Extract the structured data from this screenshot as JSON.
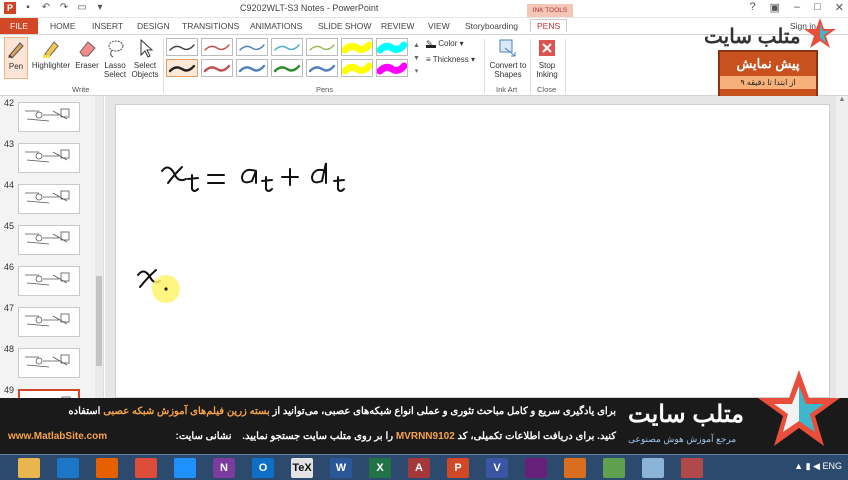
{
  "window": {
    "title": "C9202WLT-S3 Notes - PowerPoint",
    "sign_in": "Sign in"
  },
  "tabs": {
    "file": "FILE",
    "items": [
      "HOME",
      "INSERT",
      "DESIGN",
      "TRANSITIONS",
      "ANIMATIONS",
      "SLIDE SHOW",
      "REVIEW",
      "VIEW",
      "Storyboarding"
    ],
    "active": "PENS",
    "context_group": "INK TOOLS"
  },
  "ribbon": {
    "write": {
      "pen": "Pen",
      "highlighter": "Highlighter",
      "eraser": "Eraser",
      "lasso_select": "Lasso Select",
      "select_objects": "Select Objects",
      "group_label": "Write"
    },
    "pens": {
      "group_label": "Pens",
      "color": "Color",
      "thickness": "Thickness",
      "swatches_row1": [
        "#444444",
        "#c0504d",
        "#4f81bd",
        "#4bacc6",
        "#9bbb59",
        "#ffff00",
        "#00ffff"
      ],
      "swatches_row2": [
        "#222222",
        "#c0504d",
        "#4f81bd",
        "#2c8c2c",
        "#4f81bd",
        "#ffff00",
        "#ff00ff"
      ]
    },
    "ink_art": {
      "convert": "Convert to Shapes",
      "group_label": "Ink Art"
    },
    "close": {
      "stop_inking": "Stop Inking",
      "group_label": "Close"
    }
  },
  "watermark": {
    "logo": "متلب سایت",
    "promo_title": "پیش نمایش",
    "promo_sub": "از ابتدا تا دقیقه ۹"
  },
  "slides_panel": {
    "numbers": [
      "42",
      "43",
      "44",
      "45",
      "46",
      "47",
      "48",
      "49"
    ],
    "active": "49"
  },
  "banner": {
    "line1_a": "برای یادگیری سریع و کامل مباحث تئوری و عملی انواع شبکه‌های عصبی، می‌توانید از",
    "line1_highlight": "بسته زرین فیلم‌های آموزش شبکه عصبی",
    "line1_b": "استفاده",
    "line2_a": "کنید. برای دریافت اطلاعات تکمیلی، کد",
    "line2_code": "MVRNN9102",
    "line2_b": "را بر روی متلب سایت جستجو نمایید.",
    "site_label": "نشانی سایت:",
    "site_url": "www.MatlabSite.com",
    "brand": "متلب سایت",
    "brand_sub": "مرجع آموزش هوش مصنوعی"
  },
  "taskbar": {
    "apps": [
      "folder",
      "ie",
      "firefox",
      "chrome",
      "ie-blue",
      "onenote",
      "outlook",
      "tex",
      "word",
      "excel",
      "access",
      "powerpoint",
      "visio",
      "visual-studio",
      "matlab",
      "ink",
      "notes",
      "photos"
    ],
    "labels": {
      "tex": "TeX",
      "word": "W",
      "excel": "X",
      "access": "A",
      "powerpoint": "P",
      "visio": "V",
      "onenote": "N",
      "outlook": "O"
    },
    "lang": "ENG"
  }
}
